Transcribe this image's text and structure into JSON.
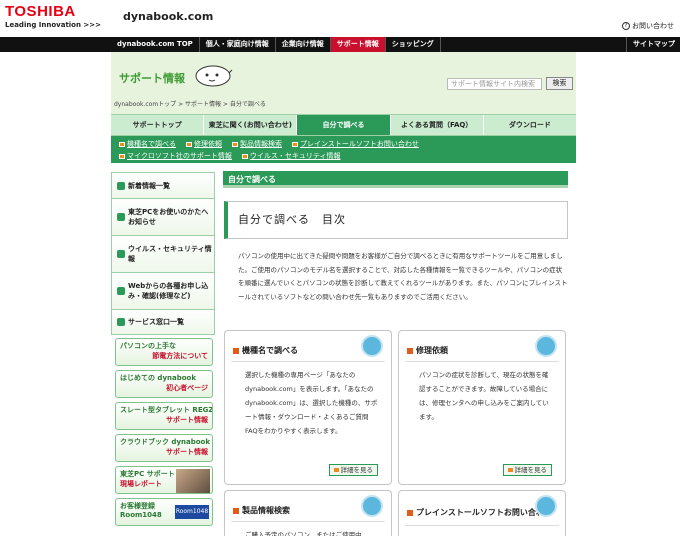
{
  "header": {
    "brand": "TOSHIBA",
    "tagline": "Leading Innovation >>>",
    "site": "dynabook.com",
    "contact": "お問い合わせ"
  },
  "topnav": [
    "dynabook.com TOP",
    "個人・家庭向け情報",
    "企業向け情報",
    "サポート情報",
    "ショッピング",
    "サイトマップ"
  ],
  "support": {
    "title": "サポート情報",
    "search_placeholder": "サポート情報サイト内検索",
    "search_button": "検索",
    "breadcrumb": "dynabook.comトップ > サポート情報 > 自分で調べる"
  },
  "tabs": [
    "サポートトップ",
    "東芝に聞く(お問い合わせ)",
    "自分で調べる",
    "よくある質問（FAQ）",
    "ダウンロード"
  ],
  "subnav": {
    "row1": [
      "機種名で調べる",
      "修理依頼",
      "製品情報検索",
      "プレインストールソフトお問い合わせ"
    ],
    "row2": [
      "マイクロソフト社のサポート情報",
      "ウイルス・セキュリティ情報"
    ]
  },
  "sidebar": [
    "新着情報一覧",
    "東芝PCをお使いのかたへお知らせ",
    "ウイルス・セキュリティ情報",
    "Webからの各種お申し込み・確認(修理など)",
    "サービス窓口一覧"
  ],
  "banners": [
    {
      "l1": "パソコンの上手な",
      "l2": "節電方法について"
    },
    {
      "l1": "はじめての dynabook",
      "l2": "初心者ページ"
    },
    {
      "l1": "スレート型タブレット REGZA Tablet",
      "l2": "サポート情報"
    },
    {
      "l1": "クラウドブック dynabook AZ",
      "l2": "サポート情報"
    },
    {
      "l1": "東芝PC サポート・サービス",
      "l2": "現場レポート"
    },
    {
      "l1": "お客様登録",
      "l2": "Room1048"
    }
  ],
  "content": {
    "section": "自分で調べる",
    "heading": "自分で調べる　目次",
    "intro": "パソコンの使用中に出てきた疑問や問題をお客様がご自分で調べるときに有用なサポートツールをご用意しました。ご使用のパソコンのモデル名を選択することで、対応した各種情報を一覧できるツールや、パソコンの症状を順番に選んでいくとパソコンの状態を診断して教えてくれるツールがあります。また、パソコンにプレインストールされているソフトなどの問い合わせ先一覧もありますのでご活用ください。",
    "cards": [
      {
        "title": "機種名で調べる",
        "body": "選択した機種の専用ページ「あなたのdynabook.com」を表示します。「あなたのdynabook.com」は、選択した機種の、サポート情報・ダウンロード・よくあるご質問FAQをわかりやすく表示します。",
        "more": "詳細を見る"
      },
      {
        "title": "修理依頼",
        "body": "パソコンの症状を診断して、現在の状態を確認することができます。故障している場合には、修理センタへの申し込みをご案内しています。",
        "more": "詳細を見る"
      },
      {
        "title": "製品情報検索",
        "body": "ご購入予定のパソコン、またはご使用中"
      },
      {
        "title": "プレインストールソフトお問い合わせ",
        "body": ""
      }
    ]
  }
}
